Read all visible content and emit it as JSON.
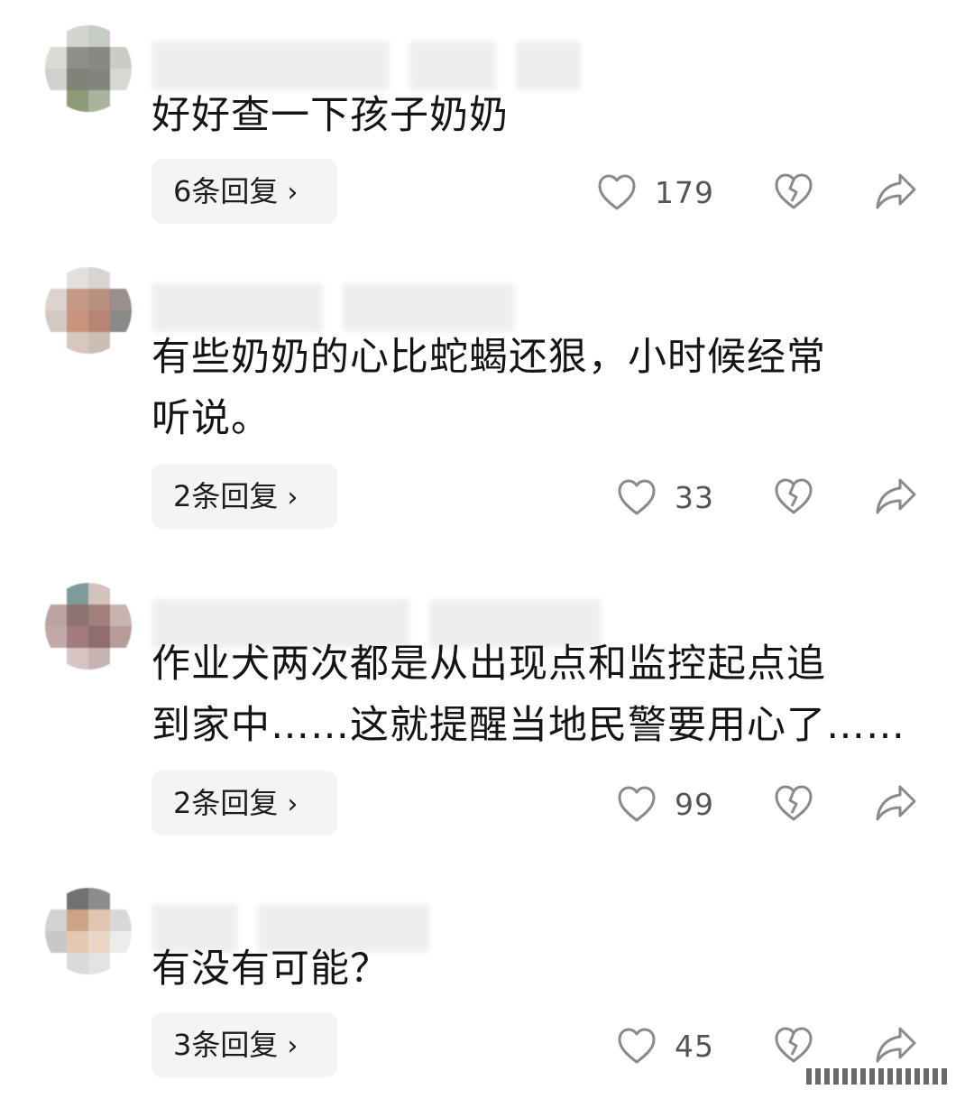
{
  "comments": [
    {
      "avatar_colors": [
        "#ffffff",
        "#d3d6cf",
        "#c7cbc5",
        "#ffffff",
        "#d9dbd5",
        "#8d9189",
        "#868a82",
        "#c9ccc6",
        "#ced2cc",
        "#7f8379",
        "#81857d",
        "#d6d8d3",
        "#ffffff",
        "#8c9a78",
        "#aab39e",
        "#ffffff"
      ],
      "text_lines": [
        "好好查一下孩子奶奶"
      ],
      "reply_label": "6条回复",
      "likes": "179"
    },
    {
      "avatar_colors": [
        "#ffffff",
        "#e4dfdc",
        "#d9d4d2",
        "#ffffff",
        "#dcd2ce",
        "#c49a86",
        "#b7907f",
        "#9a8f8b",
        "#d4c8c3",
        "#c9937d",
        "#b98573",
        "#8a8a8a",
        "#ffffff",
        "#d8c7bf",
        "#cdbdb5",
        "#ffffff"
      ],
      "text_lines": [
        "有些奶奶的心比蛇蝎还狠，小时候经常",
        "听说。"
      ],
      "reply_label": "2条回复",
      "likes": "33"
    },
    {
      "avatar_colors": [
        "#ffffff",
        "#7e9a9a",
        "#d3c3be",
        "#ffffff",
        "#b9a4a2",
        "#8f7374",
        "#a07f7c",
        "#c9b3ae",
        "#c0a9a7",
        "#a27c80",
        "#8f6d70",
        "#b79d9a",
        "#ffffff",
        "#d8c3c3",
        "#c9b2b2",
        "#ffffff"
      ],
      "text_lines": [
        "作业犬两次都是从出现点和监控起点追",
        "到家中……这就提醒当地民警要用心了……"
      ],
      "reply_label": "2条回复",
      "likes": "99"
    },
    {
      "avatar_colors": [
        "#ffffff",
        "#717171",
        "#8c8c8c",
        "#ffffff",
        "#d2d2d2",
        "#cba483",
        "#e0c6b0",
        "#d8d8d8",
        "#c8c8c8",
        "#e6c9b0",
        "#ebd7c6",
        "#ececec",
        "#ffffff",
        "#dadada",
        "#e3e3e3",
        "#ffffff"
      ],
      "text_lines": [
        "有没有可能？"
      ],
      "reply_label": "3条回复",
      "likes": "45"
    }
  ],
  "icons": {
    "like": "heart-outline-icon",
    "dislike": "broken-heart-icon",
    "share": "share-arrow-icon",
    "reply_chevron": "chevron-right-icon"
  },
  "chevron_glyph": "›"
}
